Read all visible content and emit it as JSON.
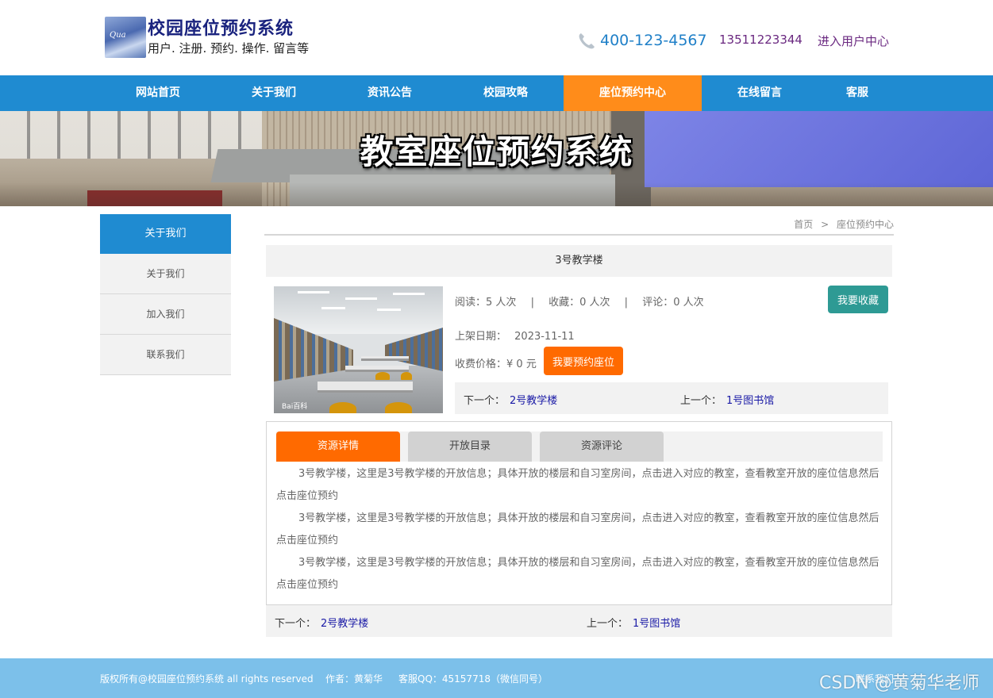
{
  "header": {
    "site_title": "校园座位预约系统",
    "site_subtitle": "用户. 注册. 预约. 操作. 留言等",
    "logo_text": "Qua",
    "phone": "400-123-4567",
    "mobile": "13511223344",
    "user_center": "进入用户中心",
    "phone_icon": "phone-icon"
  },
  "nav": {
    "items": [
      {
        "label": "网站首页"
      },
      {
        "label": "关于我们"
      },
      {
        "label": "资讯公告"
      },
      {
        "label": "校园攻略"
      },
      {
        "label": "座位预约中心"
      },
      {
        "label": "在线留言"
      },
      {
        "label": "客服"
      }
    ],
    "active_index": 4,
    "color": "#1f8bd1",
    "active_color": "#ff8c1a"
  },
  "banner": {
    "title": "教室座位预约系统"
  },
  "sidebar": {
    "heading": "关于我们",
    "items": [
      {
        "label": "关于我们"
      },
      {
        "label": "加入我们"
      },
      {
        "label": "联系我们"
      }
    ]
  },
  "breadcrumb": {
    "home": "首页",
    "sep": ">",
    "current": "座位预约中心"
  },
  "resource": {
    "title": "3号教学楼",
    "read_label": "阅读：",
    "read_value": "5 人次",
    "fav_label": "收藏：",
    "fav_value": "0 人次",
    "comment_label": "评论：",
    "comment_value": "0 人次",
    "divider": "|",
    "fav_button": "我要收藏",
    "date_label": "上架日期：",
    "date_value": "2023-11-11",
    "price_label": "收费价格：",
    "price_value": "¥ 0 元",
    "book_button": "我要预约座位",
    "next_label": "下一个：",
    "next_value": "2号教学楼",
    "prev_label": "上一个：",
    "prev_value": "1号图书馆",
    "image_watermark": "Bai百科"
  },
  "tabs": [
    {
      "label": "资源详情"
    },
    {
      "label": "开放目录"
    },
    {
      "label": "资源评论"
    }
  ],
  "detail": {
    "paragraphs": [
      "3号教学楼，这里是3号教学楼的开放信息；具体开放的楼层和自习室房间，点击进入对应的教室，查看教室开放的座位信息然后点击座位预约",
      "3号教学楼，这里是3号教学楼的开放信息；具体开放的楼层和自习室房间，点击进入对应的教室，查看教室开放的座位信息然后点击座位预约",
      "3号教学楼，这里是3号教学楼的开放信息；具体开放的楼层和自习室房间，点击进入对应的教室，查看教室开放的座位信息然后点击座位预约"
    ]
  },
  "bottom_nav": {
    "next_label": "下一个：",
    "next_value": "2号教学楼",
    "prev_label": "上一个：",
    "prev_value": "1号图书馆"
  },
  "footer": {
    "copyright": "版权所有@校园座位预约系统 all rights reserved",
    "author": "作者：黄菊华",
    "qq": "客服QQ：45157718（微信同号）",
    "contact": "联系我们"
  },
  "watermark": "CSDN @黄菊华老师"
}
